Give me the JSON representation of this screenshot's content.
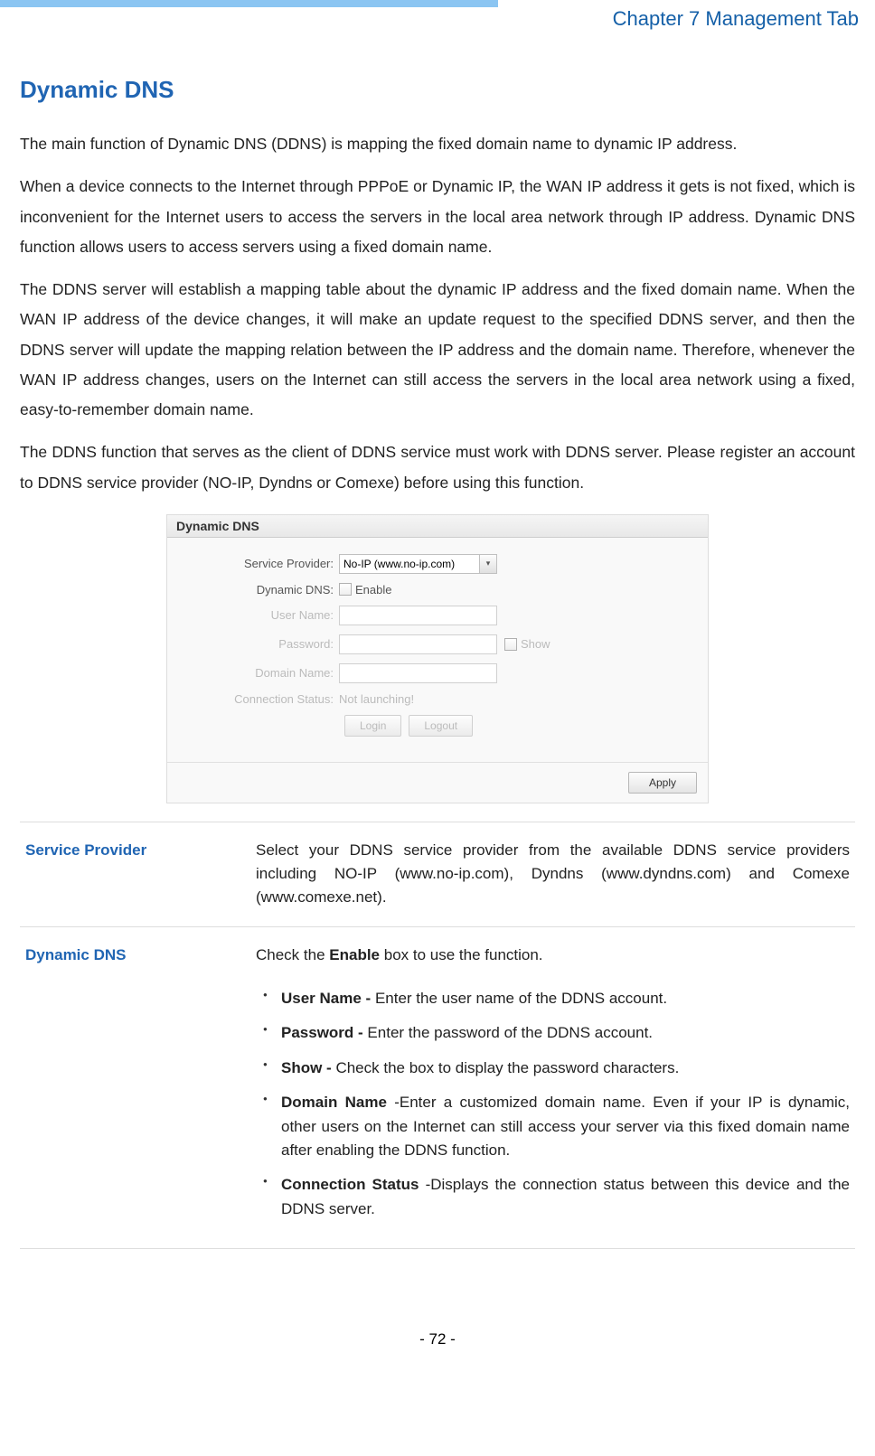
{
  "header": {
    "chapter": "Chapter 7 Management Tab"
  },
  "section": {
    "title": "Dynamic DNS",
    "paragraphs": [
      "The main function of Dynamic DNS (DDNS) is mapping the fixed domain name to dynamic IP address.",
      "When a device connects to the Internet through PPPoE or Dynamic IP, the WAN IP address it gets is not fixed, which is inconvenient for the Internet users to access the servers in the local area network through IP address. Dynamic DNS function allows users to access servers using a fixed domain name.",
      "The DDNS server will establish a mapping table about the dynamic IP address and the fixed domain name. When the WAN IP address of the device changes, it will make an update request to the specified DDNS server, and then the DDNS server will update the mapping relation between the IP address and the domain name. Therefore, whenever the WAN IP address changes, users on the Internet can still access the servers in the local area network using a fixed, easy-to-remember domain name.",
      "The DDNS function that serves as the client of DDNS service must work with DDNS server. Please register an account to DDNS service provider (NO-IP, Dyndns or Comexe) before using this function."
    ]
  },
  "panel": {
    "title": "Dynamic DNS",
    "serviceProvider": {
      "label": "Service Provider:",
      "value": "No-IP (www.no-ip.com)"
    },
    "dynamicDns": {
      "label": "Dynamic DNS:",
      "checkboxLabel": "Enable"
    },
    "userName": {
      "label": "User Name:",
      "value": ""
    },
    "password": {
      "label": "Password:",
      "value": "",
      "showLabel": "Show"
    },
    "domainName": {
      "label": "Domain Name:",
      "value": ""
    },
    "connectionStatus": {
      "label": "Connection Status:",
      "value": "Not launching!"
    },
    "buttons": {
      "login": "Login",
      "logout": "Logout",
      "apply": "Apply"
    }
  },
  "definitions": {
    "serviceProvider": {
      "term": "Service Provider",
      "desc": "Select your DDNS service provider from the available DDNS service providers including NO-IP (www.no-ip.com), Dyndns (www.dyndns.com) and Comexe (www.comexe.net)."
    },
    "dynamicDns": {
      "term": "Dynamic DNS",
      "desc_prefix": "Check the ",
      "desc_bold": "Enable",
      "desc_suffix": " box to use the function.",
      "bullets": [
        {
          "bold": "User Name - ",
          "text": "Enter the user name of the DDNS account."
        },
        {
          "bold": "Password - ",
          "text": "Enter the password of the DDNS account."
        },
        {
          "bold": "Show - ",
          "text": "Check the box to display the password characters."
        },
        {
          "bold": "Domain Name ",
          "text": "-Enter a customized domain name. Even if your IP is dynamic, other users on the Internet can still access your server via this fixed domain name after enabling the DDNS function."
        },
        {
          "bold": "Connection Status ",
          "text": "-Displays the connection status between this device and the DDNS server."
        }
      ]
    }
  },
  "footer": {
    "pageNum": "- 72 -"
  }
}
